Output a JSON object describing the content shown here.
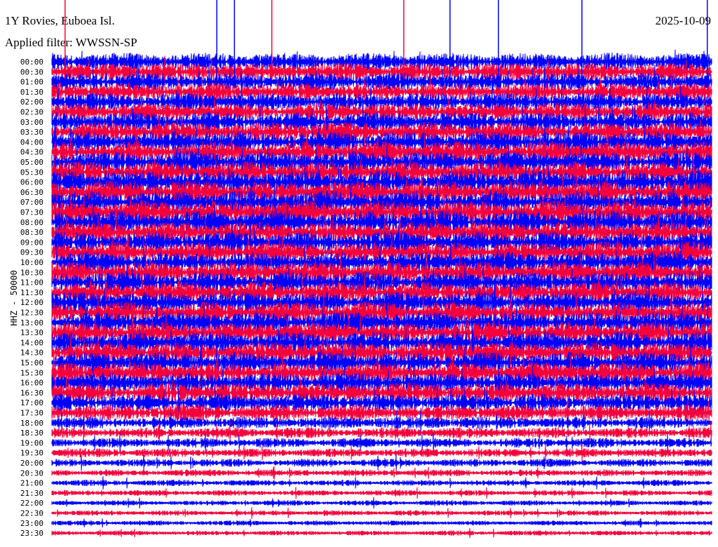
{
  "header": {
    "station": "1Y Rovies, Euboea Isl.",
    "filter": "Applied filter: WWSSN-SP",
    "date": "2025-10-09"
  },
  "chart_data": {
    "type": "line",
    "title": "1Y Rovies, Euboea Isl.",
    "ylabel": "HHZ - 50000",
    "xlabel": "",
    "minutes_per_row": 30,
    "colors": [
      "#0000ff",
      "#f5003c"
    ],
    "row_labels": [
      "00:00",
      "00:30",
      "01:00",
      "01:30",
      "02:00",
      "02:30",
      "03:00",
      "03:30",
      "04:00",
      "04:30",
      "05:00",
      "05:30",
      "06:00",
      "06:30",
      "07:00",
      "07:30",
      "08:00",
      "08:30",
      "09:00",
      "09:30",
      "10:00",
      "10:30",
      "11:00",
      "11:30",
      "12:00",
      "12:30",
      "13:00",
      "13:30",
      "14:00",
      "14:30",
      "15:00",
      "15:30",
      "16:00",
      "16:30",
      "17:00",
      "17:30",
      "18:00",
      "18:30",
      "19:00",
      "19:30",
      "20:00",
      "20:30",
      "21:00",
      "21:30",
      "22:00",
      "22:30",
      "23:00",
      "23:30"
    ],
    "relative_amplitude": [
      1.0,
      1.0,
      1.0,
      1.0,
      1.0,
      1.0,
      1.1,
      1.1,
      1.2,
      1.2,
      1.2,
      1.2,
      1.3,
      1.3,
      1.3,
      1.3,
      1.3,
      1.2,
      1.2,
      1.2,
      1.2,
      1.2,
      1.2,
      1.2,
      1.2,
      1.2,
      1.2,
      1.2,
      1.2,
      1.2,
      1.2,
      1.2,
      1.1,
      1.1,
      1.0,
      0.9,
      0.7,
      0.6,
      0.55,
      0.5,
      0.45,
      0.4,
      0.35,
      0.32,
      0.3,
      0.3,
      0.28,
      0.28
    ],
    "spikes": [
      {
        "row": "00:00",
        "minute": 0.6,
        "color": "#f5003c"
      },
      {
        "row": "00:00",
        "minute": 7.5,
        "color": "#0000ff"
      },
      {
        "row": "00:00",
        "minute": 8.3,
        "color": "#0000ff"
      },
      {
        "row": "00:00",
        "minute": 10.0,
        "color": "#f5003c"
      },
      {
        "row": "00:00",
        "minute": 16.0,
        "color": "#f5003c"
      },
      {
        "row": "00:00",
        "minute": 18.1,
        "color": "#0000ff"
      },
      {
        "row": "00:00",
        "minute": 20.3,
        "color": "#0000ff"
      },
      {
        "row": "00:00",
        "minute": 24.1,
        "color": "#0000ff"
      },
      {
        "row": "00:00",
        "minute": 29.8,
        "color": "#0000ff"
      }
    ]
  }
}
